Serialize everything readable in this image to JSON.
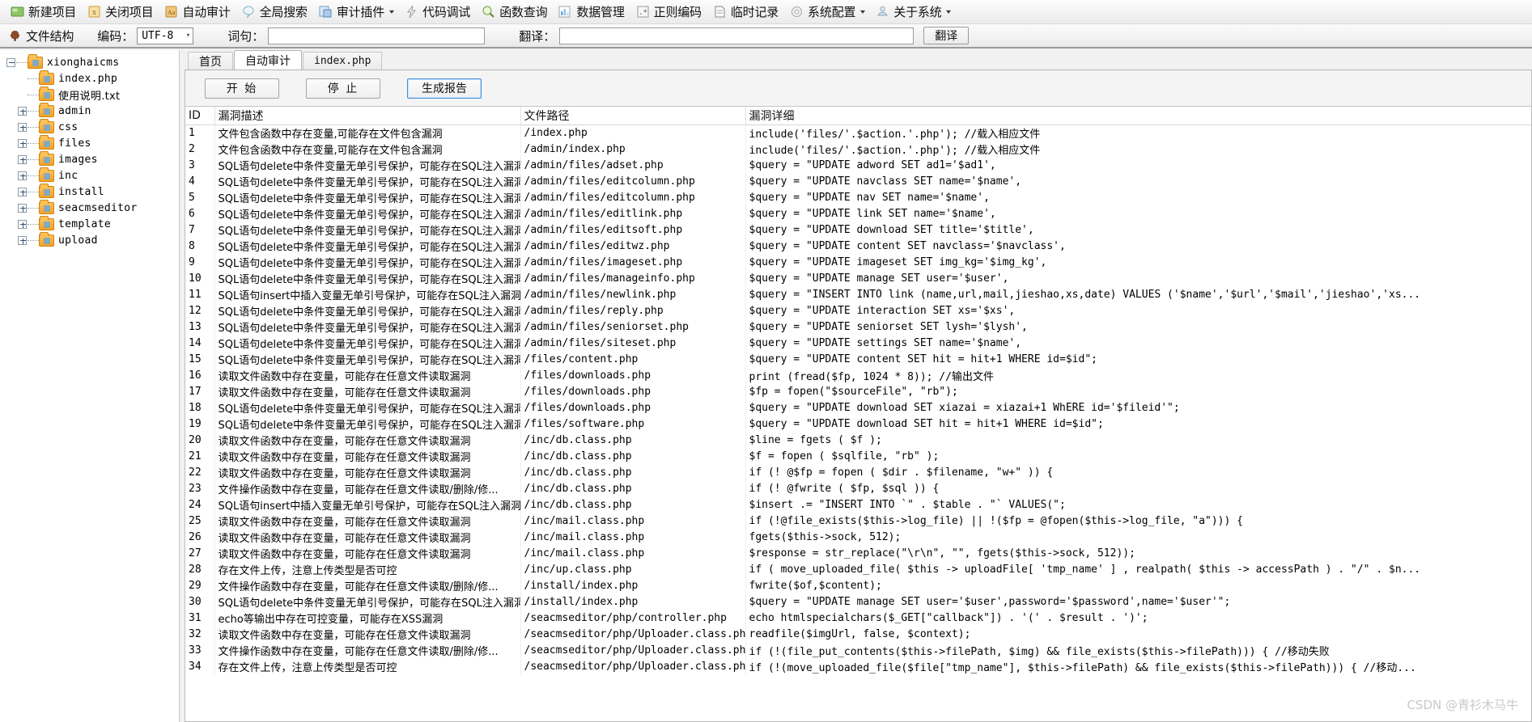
{
  "toolbar_main": {
    "items": [
      {
        "label": "新建项目",
        "icon": "new-project-icon",
        "caret": false
      },
      {
        "label": "关闭项目",
        "icon": "close-project-icon",
        "caret": false
      },
      {
        "label": "自动审计",
        "icon": "auto-audit-icon",
        "caret": false
      },
      {
        "label": "全局搜索",
        "icon": "global-search-icon",
        "caret": false
      },
      {
        "label": "审计插件",
        "icon": "audit-plugin-icon",
        "caret": true
      },
      {
        "label": "代码调试",
        "icon": "code-debug-icon",
        "caret": false
      },
      {
        "label": "函数查询",
        "icon": "function-query-icon",
        "caret": false
      },
      {
        "label": "数据管理",
        "icon": "data-manage-icon",
        "caret": false
      },
      {
        "label": "正则编码",
        "icon": "regex-encode-icon",
        "caret": false
      },
      {
        "label": "临时记录",
        "icon": "temp-note-icon",
        "caret": false
      },
      {
        "label": "系统配置",
        "icon": "system-config-icon",
        "caret": true
      },
      {
        "label": "关于系统",
        "icon": "about-system-icon",
        "caret": true
      }
    ]
  },
  "toolbar_sub": {
    "file_structure_label": "文件结构",
    "encoding_label": "编码：",
    "encoding_value": "UTF-8",
    "word_label": "词句：",
    "word_value": "",
    "word_placeholder": "",
    "translate_label": "翻译：",
    "translate_value": "",
    "translate_placeholder": "",
    "translate_button": "翻译"
  },
  "tree": {
    "root": {
      "label": "xionghaicms",
      "expanded": true
    },
    "nodes": [
      {
        "label": "index.php",
        "type": "file",
        "toggle": "none",
        "cjk": false
      },
      {
        "label": "使用说明.txt",
        "type": "file",
        "toggle": "none",
        "cjk": true
      },
      {
        "label": "admin",
        "type": "folder",
        "toggle": "plus",
        "cjk": false
      },
      {
        "label": "css",
        "type": "folder",
        "toggle": "plus",
        "cjk": false
      },
      {
        "label": "files",
        "type": "folder",
        "toggle": "plus",
        "cjk": false
      },
      {
        "label": "images",
        "type": "folder",
        "toggle": "plus",
        "cjk": false
      },
      {
        "label": "inc",
        "type": "folder",
        "toggle": "plus",
        "cjk": false
      },
      {
        "label": "install",
        "type": "folder",
        "toggle": "plus",
        "cjk": false
      },
      {
        "label": "seacmseditor",
        "type": "folder",
        "toggle": "plus",
        "cjk": false
      },
      {
        "label": "template",
        "type": "folder",
        "toggle": "plus",
        "cjk": false
      },
      {
        "label": "upload",
        "type": "folder",
        "toggle": "plus",
        "cjk": false
      }
    ]
  },
  "tabs": [
    {
      "label": "首页",
      "active": false,
      "mono": false
    },
    {
      "label": "自动审计",
      "active": true,
      "mono": false
    },
    {
      "label": "index.php",
      "active": false,
      "mono": true
    }
  ],
  "controls": {
    "start": "开 始",
    "stop": "停 止",
    "report": "生成报告"
  },
  "table": {
    "headers": [
      "ID",
      "漏洞描述",
      "文件路径",
      "漏洞详细"
    ],
    "rows": [
      {
        "id": "1",
        "desc": "文件包含函数中存在变量,可能存在文件包含漏洞",
        "path": "/index.php",
        "detail": "include('files/'.$action.'.php'); //载入相应文件"
      },
      {
        "id": "2",
        "desc": "文件包含函数中存在变量,可能存在文件包含漏洞",
        "path": "/admin/index.php",
        "detail": "include('files/'.$action.'.php'); //载入相应文件"
      },
      {
        "id": "3",
        "desc": "SQL语句delete中条件变量无单引号保护，可能存在SQL注入漏洞",
        "path": "/admin/files/adset.php",
        "detail": "$query = \"UPDATE adword SET ad1='$ad1',"
      },
      {
        "id": "4",
        "desc": "SQL语句delete中条件变量无单引号保护，可能存在SQL注入漏洞",
        "path": "/admin/files/editcolumn.php",
        "detail": "$query = \"UPDATE navclass SET name='$name',"
      },
      {
        "id": "5",
        "desc": "SQL语句delete中条件变量无单引号保护，可能存在SQL注入漏洞",
        "path": "/admin/files/editcolumn.php",
        "detail": "$query = \"UPDATE nav SET name='$name',"
      },
      {
        "id": "6",
        "desc": "SQL语句delete中条件变量无单引号保护，可能存在SQL注入漏洞",
        "path": "/admin/files/editlink.php",
        "detail": "$query = \"UPDATE link SET name='$name',"
      },
      {
        "id": "7",
        "desc": "SQL语句delete中条件变量无单引号保护，可能存在SQL注入漏洞",
        "path": "/admin/files/editsoft.php",
        "detail": "$query = \"UPDATE download SET title='$title',"
      },
      {
        "id": "8",
        "desc": "SQL语句delete中条件变量无单引号保护，可能存在SQL注入漏洞",
        "path": "/admin/files/editwz.php",
        "detail": "$query = \"UPDATE content SET navclass='$navclass',"
      },
      {
        "id": "9",
        "desc": "SQL语句delete中条件变量无单引号保护，可能存在SQL注入漏洞",
        "path": "/admin/files/imageset.php",
        "detail": "$query = \"UPDATE imageset SET img_kg='$img_kg',"
      },
      {
        "id": "10",
        "desc": "SQL语句delete中条件变量无单引号保护，可能存在SQL注入漏洞",
        "path": "/admin/files/manageinfo.php",
        "detail": "$query = \"UPDATE manage SET user='$user',"
      },
      {
        "id": "11",
        "desc": "SQL语句insert中插入变量无单引号保护，可能存在SQL注入漏洞",
        "path": "/admin/files/newlink.php",
        "detail": "$query = \"INSERT INTO link (name,url,mail,jieshao,xs,date) VALUES ('$name','$url','$mail','jieshao','xs..."
      },
      {
        "id": "12",
        "desc": "SQL语句delete中条件变量无单引号保护，可能存在SQL注入漏洞",
        "path": "/admin/files/reply.php",
        "detail": "$query = \"UPDATE interaction SET xs='$xs',"
      },
      {
        "id": "13",
        "desc": "SQL语句delete中条件变量无单引号保护，可能存在SQL注入漏洞",
        "path": "/admin/files/seniorset.php",
        "detail": "$query = \"UPDATE seniorset SET lysh='$lysh',"
      },
      {
        "id": "14",
        "desc": "SQL语句delete中条件变量无单引号保护，可能存在SQL注入漏洞",
        "path": "/admin/files/siteset.php",
        "detail": "$query = \"UPDATE settings SET name='$name',"
      },
      {
        "id": "15",
        "desc": "SQL语句delete中条件变量无单引号保护，可能存在SQL注入漏洞",
        "path": "/files/content.php",
        "detail": "$query = \"UPDATE content SET hit = hit+1 WHERE id=$id\";"
      },
      {
        "id": "16",
        "desc": "读取文件函数中存在变量，可能存在任意文件读取漏洞",
        "path": "/files/downloads.php",
        "detail": "print (fread($fp, 1024 * 8)); //输出文件"
      },
      {
        "id": "17",
        "desc": "读取文件函数中存在变量，可能存在任意文件读取漏洞",
        "path": "/files/downloads.php",
        "detail": "$fp = fopen(\"$sourceFile\", \"rb\");"
      },
      {
        "id": "18",
        "desc": "SQL语句delete中条件变量无单引号保护，可能存在SQL注入漏洞",
        "path": "/files/downloads.php",
        "detail": "$query = \"UPDATE download SET xiazai = xiazai+1 WhERE id='$fileid'\";"
      },
      {
        "id": "19",
        "desc": "SQL语句delete中条件变量无单引号保护，可能存在SQL注入漏洞",
        "path": "/files/software.php",
        "detail": "$query = \"UPDATE download SET hit = hit+1 WHERE id=$id\";"
      },
      {
        "id": "20",
        "desc": "读取文件函数中存在变量，可能存在任意文件读取漏洞",
        "path": "/inc/db.class.php",
        "detail": "$line = fgets ( $f );"
      },
      {
        "id": "21",
        "desc": "读取文件函数中存在变量，可能存在任意文件读取漏洞",
        "path": "/inc/db.class.php",
        "detail": "$f = fopen ( $sqlfile, \"rb\" );"
      },
      {
        "id": "22",
        "desc": "读取文件函数中存在变量，可能存在任意文件读取漏洞",
        "path": "/inc/db.class.php",
        "detail": "if (! @$fp = fopen ( $dir . $filename, \"w+\" )) {"
      },
      {
        "id": "23",
        "desc": "文件操作函数中存在变量，可能存在任意文件读取/删除/修...",
        "path": "/inc/db.class.php",
        "detail": "if (! @fwrite ( $fp, $sql )) {"
      },
      {
        "id": "24",
        "desc": "SQL语句insert中插入变量无单引号保护，可能存在SQL注入漏洞",
        "path": "/inc/db.class.php",
        "detail": "$insert .= \"INSERT INTO `\" . $table . \"` VALUES(\";"
      },
      {
        "id": "25",
        "desc": "读取文件函数中存在变量，可能存在任意文件读取漏洞",
        "path": "/inc/mail.class.php",
        "detail": "if (!@file_exists($this->log_file) || !($fp = @fopen($this->log_file, \"a\"))) {"
      },
      {
        "id": "26",
        "desc": "读取文件函数中存在变量，可能存在任意文件读取漏洞",
        "path": "/inc/mail.class.php",
        "detail": "fgets($this->sock, 512);"
      },
      {
        "id": "27",
        "desc": "读取文件函数中存在变量，可能存在任意文件读取漏洞",
        "path": "/inc/mail.class.php",
        "detail": "$response = str_replace(\"\\r\\n\", \"\", fgets($this->sock, 512));"
      },
      {
        "id": "28",
        "desc": "存在文件上传，注意上传类型是否可控",
        "path": "/inc/up.class.php",
        "detail": "if ( move_uploaded_file( $this -> uploadFile[ 'tmp_name' ] , realpath( $this -> accessPath ) . \"/\" . $n..."
      },
      {
        "id": "29",
        "desc": "文件操作函数中存在变量，可能存在任意文件读取/删除/修...",
        "path": "/install/index.php",
        "detail": "fwrite($of,$content);"
      },
      {
        "id": "30",
        "desc": "SQL语句delete中条件变量无单引号保护，可能存在SQL注入漏洞",
        "path": "/install/index.php",
        "detail": "$query = \"UPDATE manage SET user='$user',password='$password',name='$user'\";"
      },
      {
        "id": "31",
        "desc": "echo等输出中存在可控变量，可能存在XSS漏洞",
        "path": "/seacmseditor/php/controller.php",
        "detail": "echo htmlspecialchars($_GET[\"callback\"]) . '(' . $result . ')';"
      },
      {
        "id": "32",
        "desc": "读取文件函数中存在变量，可能存在任意文件读取漏洞",
        "path": "/seacmseditor/php/Uploader.class.php",
        "detail": "readfile($imgUrl, false, $context);"
      },
      {
        "id": "33",
        "desc": "文件操作函数中存在变量，可能存在任意文件读取/删除/修...",
        "path": "/seacmseditor/php/Uploader.class.php",
        "detail": "if (!(file_put_contents($this->filePath, $img) && file_exists($this->filePath))) { //移动失败"
      },
      {
        "id": "34",
        "desc": "存在文件上传，注意上传类型是否可控",
        "path": "/seacmseditor/php/Uploader.class.php",
        "detail": "if (!(move_uploaded_file($file[\"tmp_name\"], $this->filePath) && file_exists($this->filePath))) { //移动..."
      }
    ]
  },
  "watermark": "CSDN @青衫木马牛"
}
